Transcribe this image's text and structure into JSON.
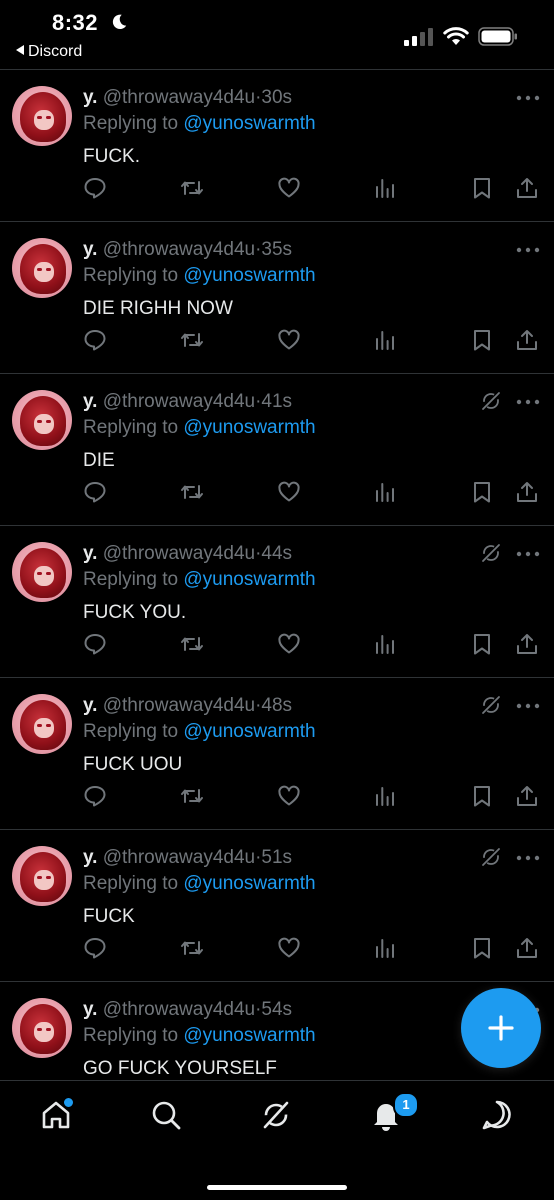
{
  "status_bar": {
    "time": "8:32",
    "back_app": "Discord"
  },
  "tweets": [
    {
      "name": "y.",
      "handle": "@throwaway4d4u",
      "time": "30s",
      "replying_prefix": "Replying to",
      "replying_to": "@yunoswarmth",
      "text": "FUCK.",
      "grok_icon": false
    },
    {
      "name": "y.",
      "handle": "@throwaway4d4u",
      "time": "35s",
      "replying_prefix": "Replying to",
      "replying_to": "@yunoswarmth",
      "text": "DIE RIGHH NOW",
      "grok_icon": false
    },
    {
      "name": "y.",
      "handle": "@throwaway4d4u",
      "time": "41s",
      "replying_prefix": "Replying to",
      "replying_to": "@yunoswarmth",
      "text": "DIE",
      "grok_icon": true
    },
    {
      "name": "y.",
      "handle": "@throwaway4d4u",
      "time": "44s",
      "replying_prefix": "Replying to",
      "replying_to": "@yunoswarmth",
      "text": "FUCK YOU.",
      "grok_icon": true
    },
    {
      "name": "y.",
      "handle": "@throwaway4d4u",
      "time": "48s",
      "replying_prefix": "Replying to",
      "replying_to": "@yunoswarmth",
      "text": "FUCK UOU",
      "grok_icon": true
    },
    {
      "name": "y.",
      "handle": "@throwaway4d4u",
      "time": "51s",
      "replying_prefix": "Replying to",
      "replying_to": "@yunoswarmth",
      "text": "FUCK",
      "grok_icon": true
    },
    {
      "name": "y.",
      "handle": "@throwaway4d4u",
      "time": "54s",
      "replying_prefix": "Replying to",
      "replying_to": "@yunoswarmth",
      "text": "GO FUCK YOURSELF",
      "grok_icon": false
    }
  ],
  "tab_bar": {
    "notifications_badge": "1",
    "home_has_new": true
  },
  "colors": {
    "accent": "#1d9bf0",
    "secondary_text": "#71767b",
    "background": "#000000",
    "divider": "#2f3336"
  },
  "icons": {
    "reply": "reply-icon",
    "retweet": "retweet-icon",
    "like": "heart-icon",
    "views": "views-icon",
    "bookmark": "bookmark-icon",
    "share": "share-icon",
    "more": "more-icon",
    "compose": "plus-icon"
  }
}
